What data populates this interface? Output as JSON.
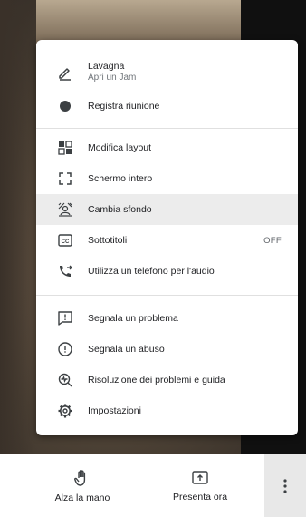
{
  "menu": {
    "items": [
      {
        "name": "whiteboard",
        "label": "Lavagna",
        "sublabel": "Apri un Jam",
        "icon": "pen-icon"
      },
      {
        "name": "record-meeting",
        "label": "Registra riunione",
        "icon": "record-dot-icon"
      },
      {
        "name": "change-layout",
        "label": "Modifica layout",
        "icon": "layout-grid-icon"
      },
      {
        "name": "full-screen",
        "label": "Schermo intero",
        "icon": "fullscreen-icon"
      },
      {
        "name": "change-background",
        "label": "Cambia sfondo",
        "icon": "background-effects-icon"
      },
      {
        "name": "captions",
        "label": "Sottotitoli",
        "right": "OFF",
        "icon": "closed-captions-icon"
      },
      {
        "name": "phone-audio",
        "label": "Utilizza un telefono per l'audio",
        "icon": "phone-forward-icon"
      },
      {
        "name": "report-problem",
        "label": "Segnala un problema",
        "icon": "feedback-icon"
      },
      {
        "name": "report-abuse",
        "label": "Segnala un abuso",
        "icon": "alert-circle-icon"
      },
      {
        "name": "troubleshooting",
        "label": "Risoluzione dei problemi e guida",
        "icon": "troubleshoot-icon"
      },
      {
        "name": "settings",
        "label": "Impostazioni",
        "icon": "gear-icon"
      }
    ]
  },
  "bottom_bar": {
    "raise_hand": "Alza la mano",
    "present_now": "Presenta ora",
    "more_icon": "more-vertical-icon"
  },
  "colors": {
    "highlight": "#ececec",
    "icon": "#3c4043",
    "text": "#202124"
  }
}
